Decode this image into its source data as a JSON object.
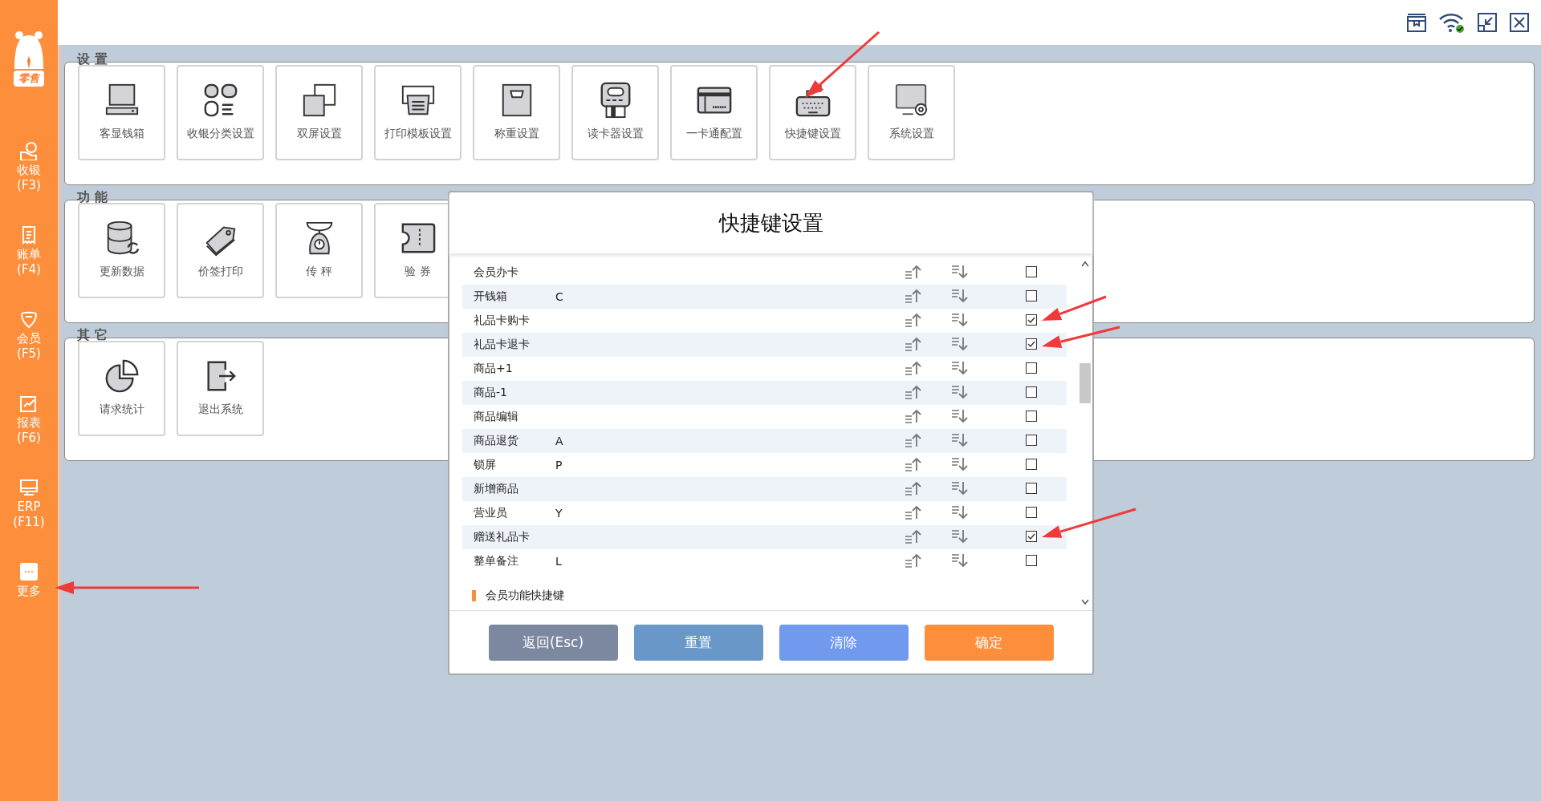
{
  "sidebar": {
    "logo_text": "零售",
    "items": [
      {
        "label": "收银",
        "key": "(F3)"
      },
      {
        "label": "账单",
        "key": "(F4)"
      },
      {
        "label": "会员",
        "key": "(F5)"
      },
      {
        "label": "报表",
        "key": "(F6)"
      },
      {
        "label": "ERP",
        "key": "(F11)"
      },
      {
        "label": "更多"
      }
    ]
  },
  "sections": [
    {
      "title": "设 置",
      "tiles": [
        "客显钱箱",
        "收银分类设置",
        "双屏设置",
        "打印模板设置",
        "称重设置",
        "读卡器设置",
        "一卡通配置",
        "快捷键设置",
        "系统设置"
      ]
    },
    {
      "title": "功 能",
      "tiles": [
        "更新数据",
        "价签打印",
        "传 秤",
        "验 券"
      ]
    },
    {
      "title": "其 它",
      "tiles": [
        "请求统计",
        "退出系统"
      ]
    }
  ],
  "dialog": {
    "title": "快捷键设置",
    "rows": [
      {
        "name": "会员办卡",
        "checked": false
      },
      {
        "name": "开钱箱",
        "key": "C",
        "checked": false
      },
      {
        "name": "礼品卡购卡",
        "checked": true
      },
      {
        "name": "礼品卡退卡",
        "checked": true
      },
      {
        "name": "商品+1",
        "checked": false
      },
      {
        "name": "商品-1",
        "checked": false
      },
      {
        "name": "商品编辑",
        "checked": false
      },
      {
        "name": "商品退货",
        "key": "A",
        "checked": false
      },
      {
        "name": "锁屏",
        "key": "P",
        "checked": false
      },
      {
        "name": "新增商品",
        "checked": false
      },
      {
        "name": "营业员",
        "key": "Y",
        "checked": false
      },
      {
        "name": "赠送礼品卡",
        "checked": true
      },
      {
        "name": "整单备注",
        "key": "L",
        "checked": false
      }
    ],
    "group_header": "会员功能快捷键",
    "buttons": [
      "返回(Esc)",
      "重置",
      "清除",
      "确定"
    ]
  }
}
